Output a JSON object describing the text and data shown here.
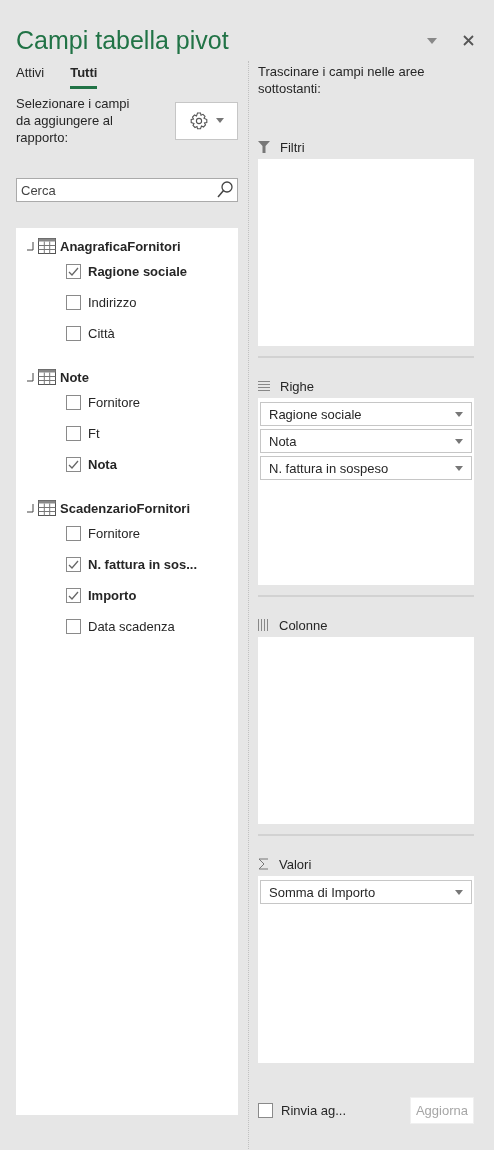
{
  "title": "Campi tabella pivot",
  "tabs": [
    {
      "label": "Attivi",
      "selected": false
    },
    {
      "label": "Tutti",
      "selected": true
    }
  ],
  "instructions": "Selezionare i campi da aggiungere al rapporto:",
  "search": {
    "placeholder": "Cerca"
  },
  "tables": [
    {
      "name": "AnagraficaFornitori",
      "expanded": true,
      "fields": [
        {
          "label": "Ragione sociale",
          "checked": true
        },
        {
          "label": "Indirizzo",
          "checked": false
        },
        {
          "label": "Città",
          "checked": false
        }
      ]
    },
    {
      "name": "Note",
      "expanded": true,
      "fields": [
        {
          "label": "Fornitore",
          "checked": false
        },
        {
          "label": "Ft",
          "checked": false
        },
        {
          "label": "Nota",
          "checked": true
        }
      ]
    },
    {
      "name": "ScadenzarioFornitori",
      "expanded": true,
      "fields": [
        {
          "label": "Fornitore",
          "checked": false
        },
        {
          "label": "N. fattura in sos...",
          "checked": true
        },
        {
          "label": "Importo",
          "checked": true
        },
        {
          "label": "Data scadenza",
          "checked": false
        }
      ]
    }
  ],
  "areas_hint": "Trascinare i campi nelle aree sottostanti:",
  "areas": [
    {
      "kind": "filters",
      "label": "Filtri"
    },
    {
      "kind": "rows",
      "label": "Righe",
      "items": [
        "Ragione sociale",
        "Nota",
        "N. fattura in sospeso"
      ]
    },
    {
      "kind": "columns",
      "label": "Colonne"
    },
    {
      "kind": "values",
      "label": "Valori",
      "items": [
        "Somma di Importo"
      ]
    }
  ],
  "defer": {
    "label": "Rinvia ag...",
    "checked": false
  },
  "update_button": {
    "label": "Aggiorna",
    "disabled": true
  }
}
